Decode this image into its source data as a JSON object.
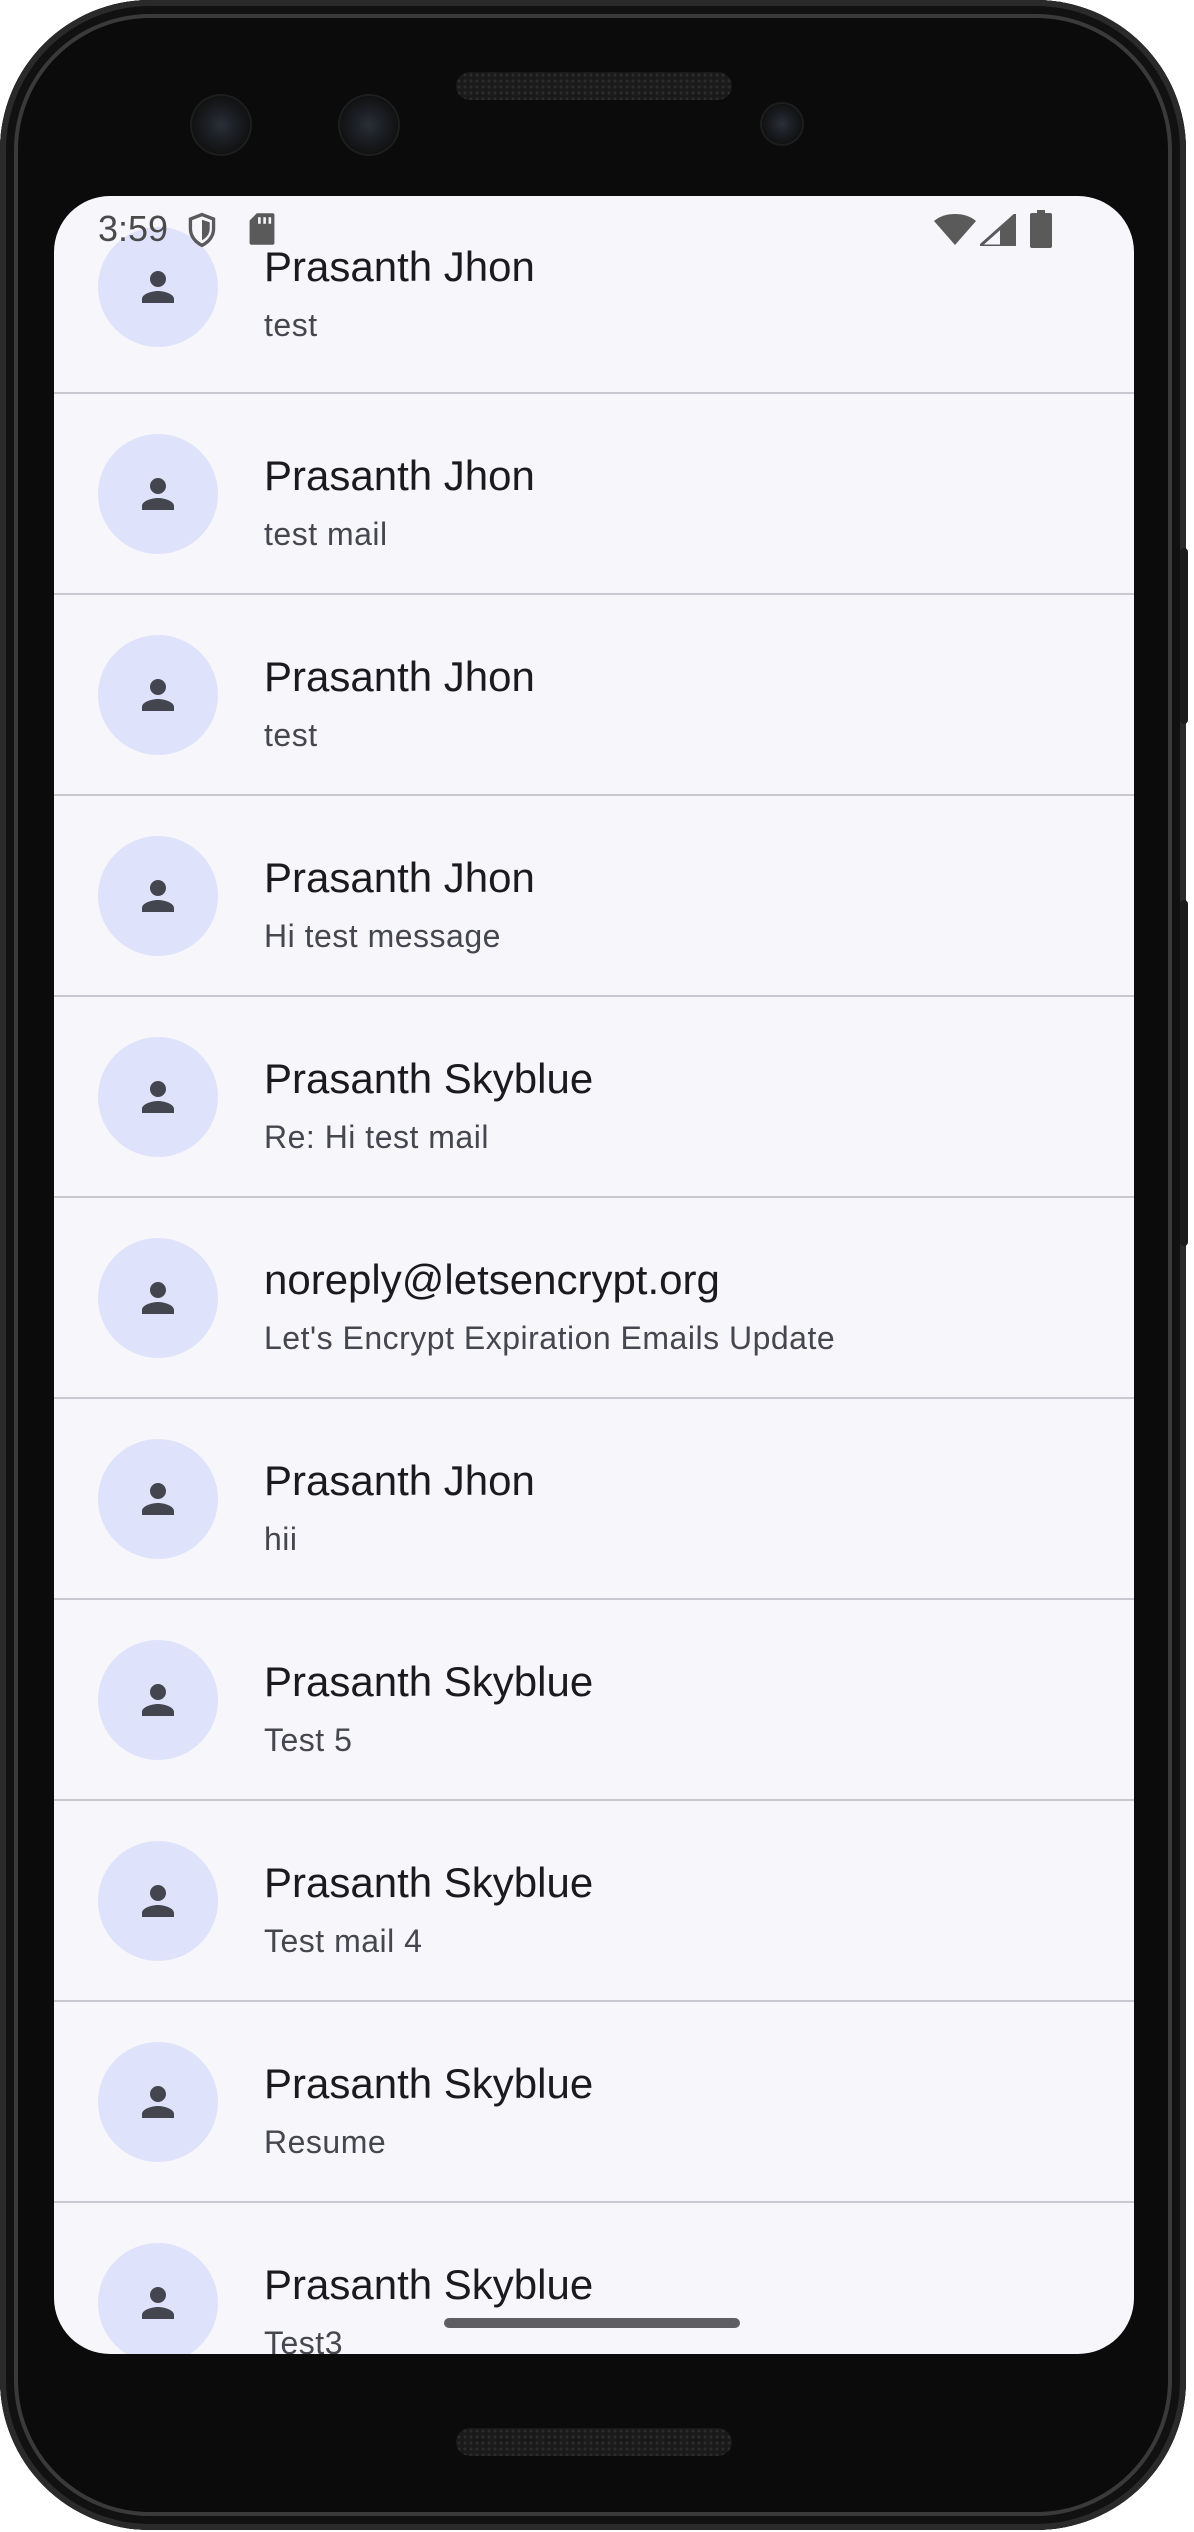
{
  "status_bar": {
    "time": "3:59",
    "icons": [
      "shield-icon",
      "sd-card-icon",
      "wifi-icon",
      "signal-icon",
      "battery-icon"
    ]
  },
  "colors": {
    "screen_background": "#f7f6fb",
    "avatar_background": "#dee3fb",
    "avatar_icon": "#44464f",
    "divider": "#c9c7cf"
  },
  "emails": [
    {
      "sender": "Prasanth Jhon",
      "subject": "test"
    },
    {
      "sender": "Prasanth Jhon",
      "subject": "test mail"
    },
    {
      "sender": "Prasanth Jhon",
      "subject": "test"
    },
    {
      "sender": "Prasanth Jhon",
      "subject": "Hi test message"
    },
    {
      "sender": "Prasanth Skyblue",
      "subject": "Re: Hi test mail"
    },
    {
      "sender": "noreply@letsencrypt.org",
      "subject": "Let's Encrypt Expiration Emails Update"
    },
    {
      "sender": "Prasanth Jhon",
      "subject": "hii"
    },
    {
      "sender": "Prasanth Skyblue",
      "subject": "Test 5"
    },
    {
      "sender": "Prasanth Skyblue",
      "subject": "Test mail 4"
    },
    {
      "sender": "Prasanth Skyblue",
      "subject": "Resume"
    },
    {
      "sender": "Prasanth Skyblue",
      "subject": "Test3"
    }
  ]
}
